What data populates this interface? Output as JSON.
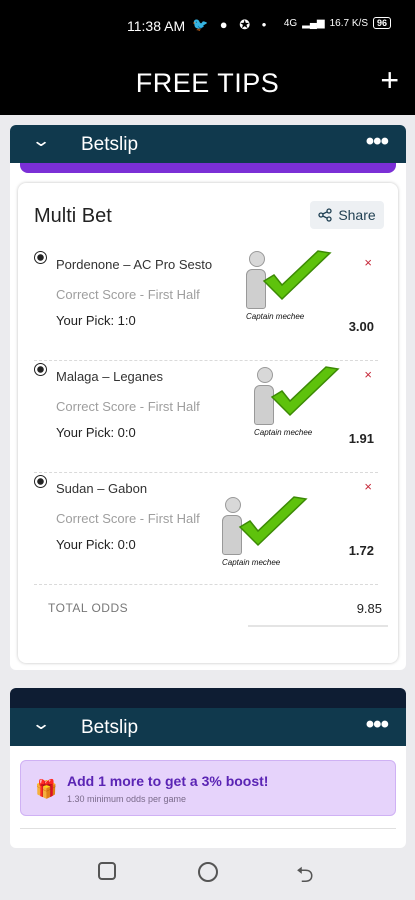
{
  "status_bar": {
    "time": "11:38 AM",
    "left_icons": "🐦 ● ✪ •",
    "network": "4G",
    "speed": "16.7 K/S",
    "battery": "96"
  },
  "app": {
    "title": "FREE TIPS",
    "add_label": "+"
  },
  "betslip1": {
    "title": "Betslip",
    "menu": "•••",
    "heading": "Multi Bet",
    "share_label": "Share",
    "bets": [
      {
        "match": "Pordenone – AC Pro Sesto",
        "market": "Correct Score - First Half",
        "pick": "Your Pick: 1:0",
        "odds": "3.00",
        "remove": "×"
      },
      {
        "match": "Malaga – Leganes",
        "market": "Correct Score - First Half",
        "pick": "Your Pick: 0:0",
        "odds": "1.91",
        "remove": "×"
      },
      {
        "match": "Sudan – Gabon",
        "market": "Correct Score - First Half",
        "pick": "Your Pick: 0:0",
        "odds": "1.72",
        "remove": "×"
      }
    ],
    "total_label": "TOTAL ODDS",
    "total_value": "9.85"
  },
  "badge": {
    "caption": "Captain mechee"
  },
  "betslip2": {
    "title": "Betslip",
    "menu": "•••",
    "boost_title": "Add 1 more to get a 3% boost!",
    "boost_sub": "1.30 minimum odds per game"
  },
  "colors": {
    "header": "#10394d",
    "accent": "#7b2fd6",
    "boost_bg": "#e6d3fb",
    "remove": "#c62839",
    "tick": "#5ec20c"
  },
  "icons": {
    "expand": "chevron-down-icon",
    "share": "share-icon",
    "gift": "gift-icon",
    "ball": "soccer-ball-icon"
  }
}
